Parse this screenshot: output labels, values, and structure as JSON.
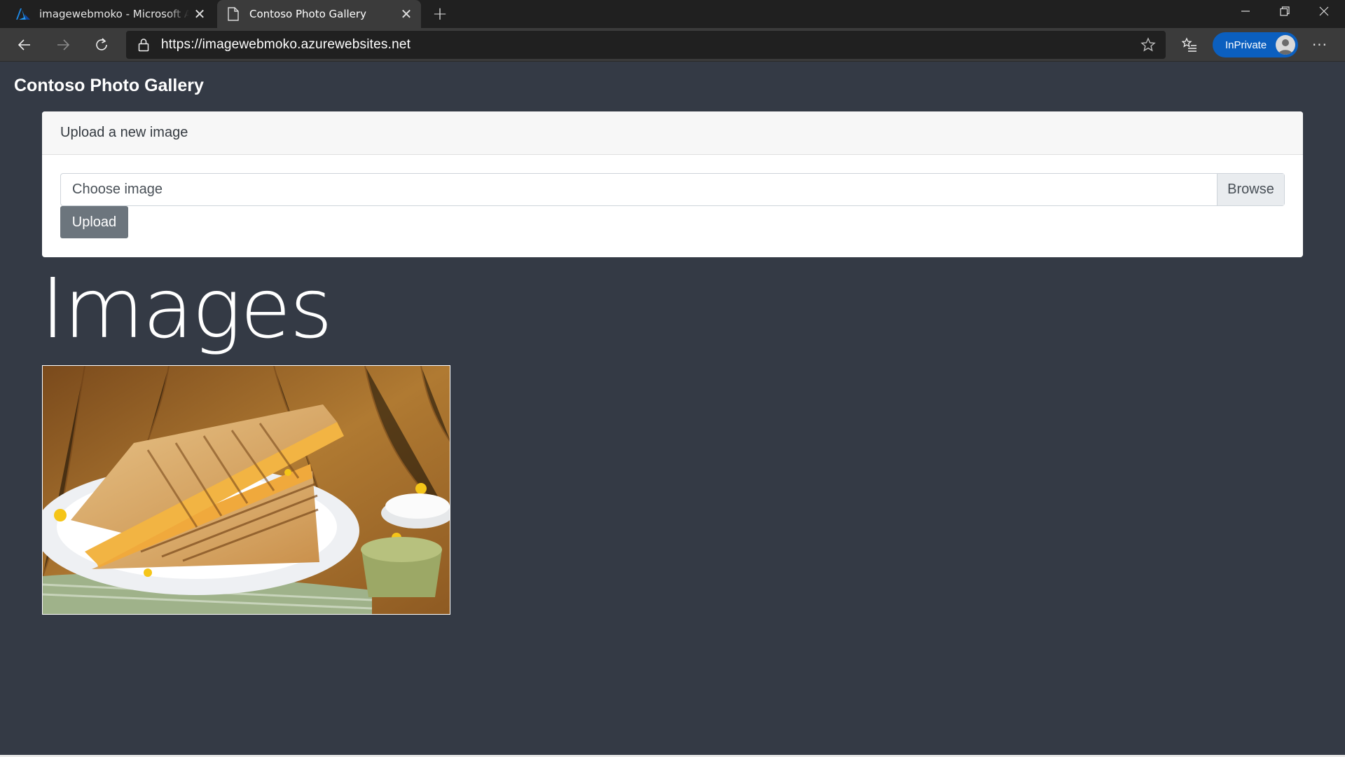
{
  "browser": {
    "tabs": [
      {
        "title": "imagewebmoko - Microsoft Azure",
        "favicon": "azure-icon",
        "active": false
      },
      {
        "title": "Contoso Photo Gallery",
        "favicon": "page-icon",
        "active": true
      }
    ],
    "url": "https://imagewebmoko.azurewebsites.net",
    "inprivate_label": "InPrivate",
    "accent": "#0b5fbf"
  },
  "page": {
    "brand": "Contoso Photo Gallery",
    "upload_card": {
      "header": "Upload a new image",
      "file_label": "Choose image",
      "browse_label": "Browse",
      "upload_label": "Upload"
    },
    "images_heading": "Images",
    "images": [
      {
        "alt": "grilled-sandwich-photo"
      }
    ],
    "background": "#343a45"
  }
}
